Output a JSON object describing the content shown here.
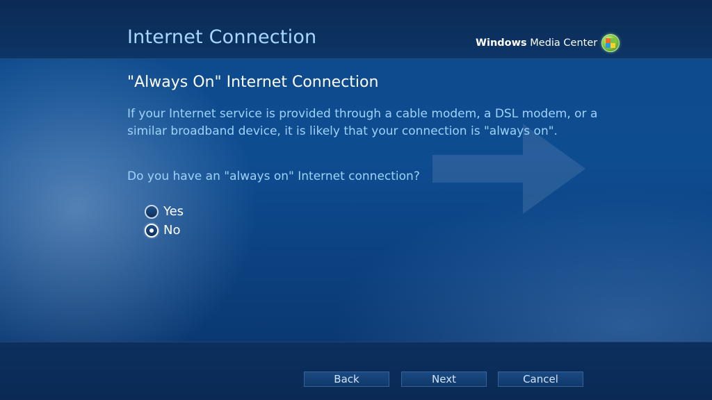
{
  "window": {
    "title": "Internet Connection",
    "brand": {
      "bold": "Windows",
      "rest": " Media Center"
    }
  },
  "content": {
    "subtitle": "\"Always On\" Internet Connection",
    "description": "If your Internet service is provided through a cable modem, a DSL modem, or a similar broadband device, it is likely that your connection is \"always on\".",
    "question": "Do you have an \"always on\" Internet connection?",
    "options": [
      {
        "label": "Yes",
        "selected": false
      },
      {
        "label": "No",
        "selected": true
      }
    ]
  },
  "buttons": {
    "back": "Back",
    "next": "Next",
    "cancel": "Cancel"
  },
  "icons": {
    "logo": "windows-flag-icon",
    "radio": "radio-button-icon"
  },
  "colors": {
    "background": "#0e4c90",
    "title": "#a9d8ff",
    "body_text": "#9fd3ff",
    "accent": "#7cc242"
  }
}
